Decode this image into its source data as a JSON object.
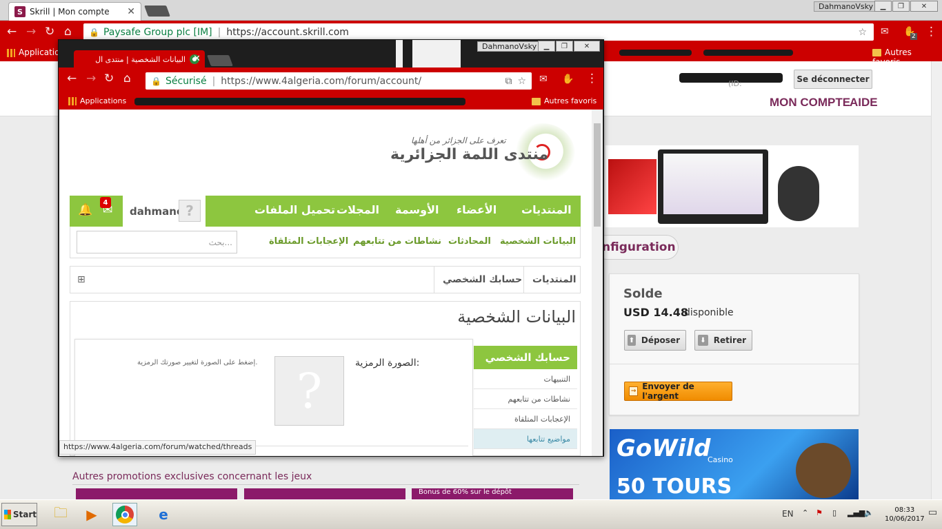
{
  "back_browser": {
    "tab_title": "Skrill | Mon compte",
    "window_user": "DahmanoVsky",
    "address_owner": "Paysafe Group plc [IM]",
    "address_url": "https://account.skrill.com",
    "bookmarks": {
      "apps": "Applications",
      "other": "Autres favoris"
    },
    "extension_badge": "2"
  },
  "skrill": {
    "logout_label": "Se déconnecter",
    "id_label": "(ID:",
    "nav": {
      "account": "MON COMPTE",
      "help": "AIDE"
    },
    "config_label": "nfiguration",
    "balance": {
      "title": "Solde",
      "amount": "USD 14.48",
      "available": "disponible"
    },
    "buttons": {
      "deposit": "Déposer",
      "withdraw": "Retirer",
      "send": "Envoyer de l'argent"
    },
    "promo_title": "Autres promotions exclusives concernant les jeux",
    "promo_tile_text": "Bonus de 60% sur le dépôt",
    "gowild": {
      "brand": "GoWild",
      "casino": "Casino",
      "tours": "50 TOURS"
    }
  },
  "front_browser": {
    "window_user": "DahmanoVsky",
    "tab_title": "البيانات الشخصية | منتدى ال",
    "secure_label": "Sécurisé",
    "address_url": "https://www.4algeria.com/forum/account/",
    "bookmarks": {
      "apps": "Applications",
      "other": "Autres favoris"
    },
    "status_url": "https://www.4algeria.com/forum/watched/threads"
  },
  "forum": {
    "logo_title": "منتدى اللمة الجزائرية",
    "logo_tagline": "تعرف على الجزائر من أهلها",
    "username": "dahmano",
    "notification_count": "4",
    "nav": [
      "المنتديات",
      "الأعضاء",
      "الأوسمة",
      "المجلات",
      "تحميل الملفات"
    ],
    "subnav": [
      "البيانات الشخصية",
      "المحادثات",
      "نشاطات من تتابعهم",
      "الإعجابات المتلقاة"
    ],
    "search_placeholder": "بحث...",
    "breadcrumb": [
      "المنتديات",
      "حسابك الشخصي"
    ],
    "page_heading": "البيانات الشخصية",
    "sidebar_heading": "حسابك الشخصي",
    "sidebar_items": [
      "التنبيهات",
      "نشاطات من تتابعهم",
      "الإعجابات المتلقاة",
      "مواضيع تتابعها"
    ],
    "avatar_label": "الصورة الرمزية:",
    "avatar_hint": "إضغط على الصورة لتغيير صورتك الرمزية."
  },
  "taskbar": {
    "start_label": "Start",
    "language": "EN",
    "time": "08:33",
    "date": "10/06/2017"
  },
  "colors": {
    "chrome_red": "#cc0000",
    "forum_green": "#8dc63f",
    "skrill_purple": "#7a2a5a",
    "send_orange": "#f08c00"
  }
}
